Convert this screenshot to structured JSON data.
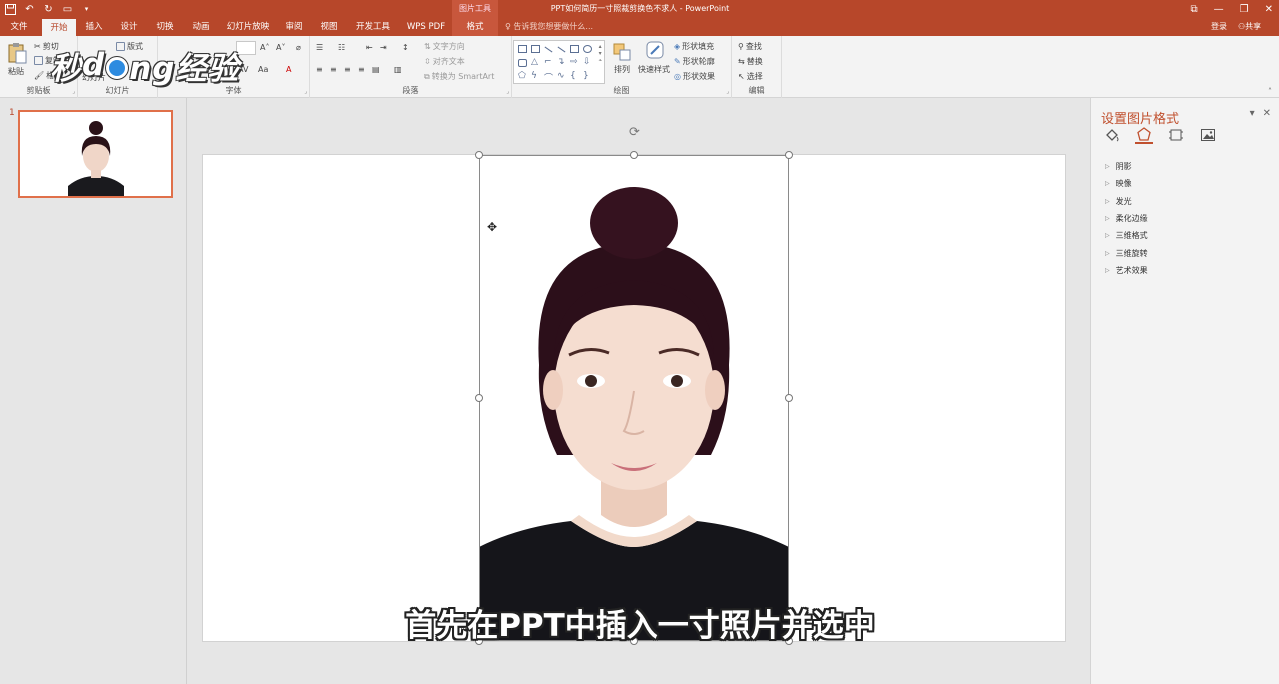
{
  "window": {
    "title": "PPT如何简历一寸照裁剪换色不求人 - PowerPoint",
    "context_group": "图片工具"
  },
  "tabs": [
    {
      "label": "文件"
    },
    {
      "label": "开始",
      "active": true
    },
    {
      "label": "插入"
    },
    {
      "label": "设计"
    },
    {
      "label": "切换"
    },
    {
      "label": "动画"
    },
    {
      "label": "幻灯片放映"
    },
    {
      "label": "审阅"
    },
    {
      "label": "视图"
    },
    {
      "label": "开发工具"
    },
    {
      "label": "WPS PDF"
    },
    {
      "label": "格式",
      "contextual": true
    }
  ],
  "tell_me": "告诉我您想要做什么...",
  "account": {
    "login": "登录",
    "share": "共享"
  },
  "ribbon": {
    "clipboard": {
      "label": "剪贴板",
      "paste": "粘贴",
      "cut": "剪切",
      "copy": "复制",
      "painter": "格"
    },
    "slides": {
      "label": "幻灯片",
      "layout": "版式",
      "new": "幻灯片"
    },
    "font": {
      "label": "字体"
    },
    "paragraph": {
      "label": "段落",
      "text_dir": "文字方向",
      "align_text": "对齐文本",
      "smartart": "转换为 SmartArt"
    },
    "drawing": {
      "label": "绘图",
      "arrange": "排列",
      "quick_styles": "快速样式",
      "fill": "形状填充",
      "outline": "形状轮廓",
      "effects": "形状效果"
    },
    "editing": {
      "label": "编辑",
      "find": "查找",
      "replace": "替换",
      "select": "选择"
    }
  },
  "watermark": {
    "left": "秒",
    "right": "ng经验",
    "mid": "d"
  },
  "thumbnails": {
    "slide_number": "1"
  },
  "subtitle": "首先在PPT中插入一寸照片并选中",
  "format_pane": {
    "title": "设置图片格式",
    "tabs": [
      "fill-line-icon",
      "effects-icon",
      "size-properties-icon",
      "picture-icon"
    ],
    "items": [
      "阴影",
      "映像",
      "发光",
      "柔化边缘",
      "三维格式",
      "三维旋转",
      "艺术效果"
    ]
  },
  "colors": {
    "accent": "#b7472a",
    "pane_title": "#c0502e"
  }
}
